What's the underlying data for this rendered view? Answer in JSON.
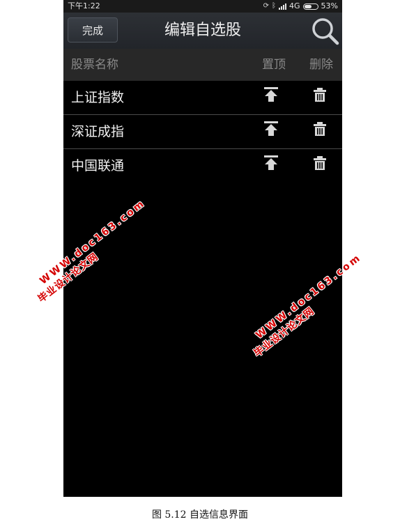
{
  "status_bar": {
    "time": "下午1:22",
    "network": "4G",
    "battery": "53%",
    "battery_level": 0.53
  },
  "header": {
    "done_label": "完成",
    "title": "编辑自选股",
    "search_icon": "search-icon"
  },
  "columns": {
    "name": "股票名称",
    "top": "置顶",
    "delete": "删除"
  },
  "stocks": [
    {
      "name": "上证指数"
    },
    {
      "name": "深证成指"
    },
    {
      "name": "中国联通"
    }
  ],
  "watermark": {
    "url": "WWW.doc163.com",
    "text": "毕业设计论文网"
  },
  "caption": "图 5.12 自选信息界面",
  "colors": {
    "background": "#000000",
    "header": "#2d3035",
    "column_header": "#282828",
    "watermark": "#d40000"
  }
}
